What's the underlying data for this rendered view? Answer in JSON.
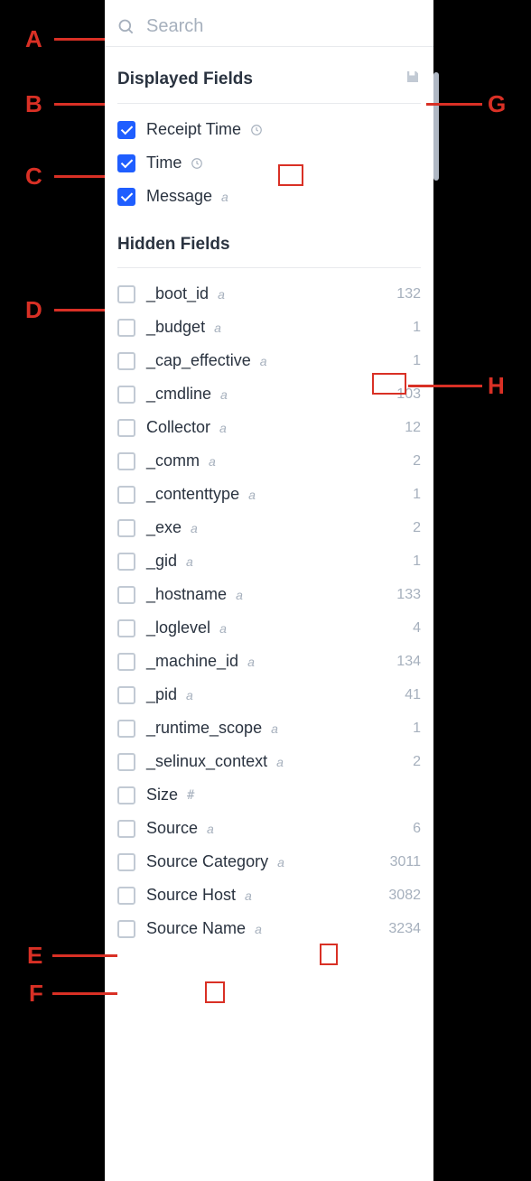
{
  "search": {
    "placeholder": "Search"
  },
  "sections": {
    "displayed_title": "Displayed Fields",
    "hidden_title": "Hidden Fields"
  },
  "displayed_fields": [
    {
      "label": "Receipt Time",
      "type": "clock"
    },
    {
      "label": "Time",
      "type": "clock"
    },
    {
      "label": "Message",
      "type": "a"
    }
  ],
  "hidden_fields": [
    {
      "label": "_boot_id",
      "type": "a",
      "count": 132
    },
    {
      "label": "_budget",
      "type": "a",
      "count": 1
    },
    {
      "label": "_cap_effective",
      "type": "a",
      "count": 1
    },
    {
      "label": "_cmdline",
      "type": "a",
      "count": 103
    },
    {
      "label": "Collector",
      "type": "a",
      "count": 12
    },
    {
      "label": "_comm",
      "type": "a",
      "count": 2
    },
    {
      "label": "_contenttype",
      "type": "a",
      "count": 1
    },
    {
      "label": "_exe",
      "type": "a",
      "count": 2
    },
    {
      "label": "_gid",
      "type": "a",
      "count": 1
    },
    {
      "label": "_hostname",
      "type": "a",
      "count": 133
    },
    {
      "label": "_loglevel",
      "type": "a",
      "count": 4
    },
    {
      "label": "_machine_id",
      "type": "a",
      "count": 134
    },
    {
      "label": "_pid",
      "type": "a",
      "count": 41
    },
    {
      "label": "_runtime_scope",
      "type": "a",
      "count": 1
    },
    {
      "label": "_selinux_context",
      "type": "a",
      "count": 2
    },
    {
      "label": "Size",
      "type": "hash",
      "count": ""
    },
    {
      "label": "Source",
      "type": "a",
      "count": 6
    },
    {
      "label": "Source Category",
      "type": "a",
      "count": 3011
    },
    {
      "label": "Source Host",
      "type": "a",
      "count": 3082
    },
    {
      "label": "Source Name",
      "type": "a",
      "count": 3234
    }
  ],
  "annotations": [
    "A",
    "B",
    "C",
    "D",
    "E",
    "F",
    "G",
    "H"
  ]
}
